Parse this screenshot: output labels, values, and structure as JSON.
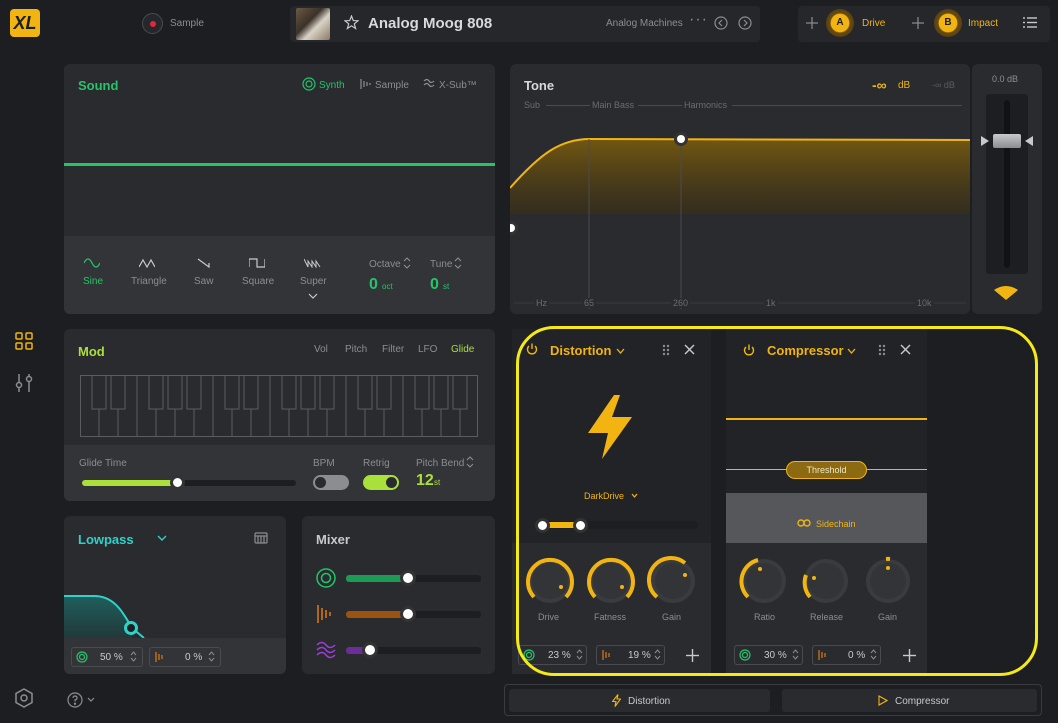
{
  "colors": {
    "green": "#24c46a",
    "yellow": "#f1b411",
    "cyan": "#2fd2c9",
    "lime": "#a9e03a",
    "purple": "#9b3fd6",
    "orange": "#e07a12",
    "highlight": "#f5ea17"
  },
  "app": {
    "logo": "XL",
    "record_label": "Sample",
    "preset_name": "Analog Moog 808",
    "preset_category": "Analog Machines"
  },
  "macros": [
    {
      "letter": "A",
      "label": "Drive"
    },
    {
      "letter": "B",
      "label": "Impact"
    }
  ],
  "sound": {
    "title": "Sound",
    "modes": [
      "Synth",
      "Sample",
      "X-Sub™"
    ],
    "waves": [
      "Sine",
      "Triangle",
      "Saw",
      "Square",
      "Super"
    ],
    "octave_label": "Octave",
    "octave_value": "0",
    "octave_unit": "oct",
    "tune_label": "Tune",
    "tune_value": "0",
    "tune_unit": "st"
  },
  "tone": {
    "title": "Tone",
    "gain_value": "-∞",
    "gain_unit": "dB",
    "gain_ref": "-∞ dB",
    "fader_value": "0.0 dB",
    "bands": [
      "Sub",
      "Main Bass",
      "Harmonics"
    ],
    "freq_ticks": [
      "Hz",
      "65",
      "260",
      "1k",
      "10k"
    ]
  },
  "mod": {
    "title": "Mod",
    "tabs": [
      "Vol",
      "Pitch",
      "Filter",
      "LFO",
      "Glide"
    ],
    "glide_time_label": "Glide Time",
    "glide_time_fraction": 0.45,
    "bpm_label": "BPM",
    "retrig_label": "Retrig",
    "pitch_bend_label": "Pitch Bend",
    "pitch_bend_value": "12",
    "pitch_bend_unit": "st"
  },
  "filter": {
    "title": "Lowpass",
    "amount": "50 %",
    "drive": "0 %"
  },
  "mixer": {
    "title": "Mixer",
    "levels": [
      0.46,
      0.46,
      0.18
    ]
  },
  "distortion": {
    "title": "Distortion",
    "type": "DarkDrive",
    "knobs": [
      "Drive",
      "Fatness",
      "Gain"
    ],
    "mix": "23 %",
    "amount": "19 %"
  },
  "compressor": {
    "title": "Compressor",
    "threshold_label": "Threshold",
    "sidechain_label": "Sidechain",
    "knobs": [
      "Ratio",
      "Release",
      "Gain"
    ],
    "mix": "30 %",
    "amount": "0 %"
  },
  "chain": [
    "Distortion",
    "Compressor"
  ]
}
